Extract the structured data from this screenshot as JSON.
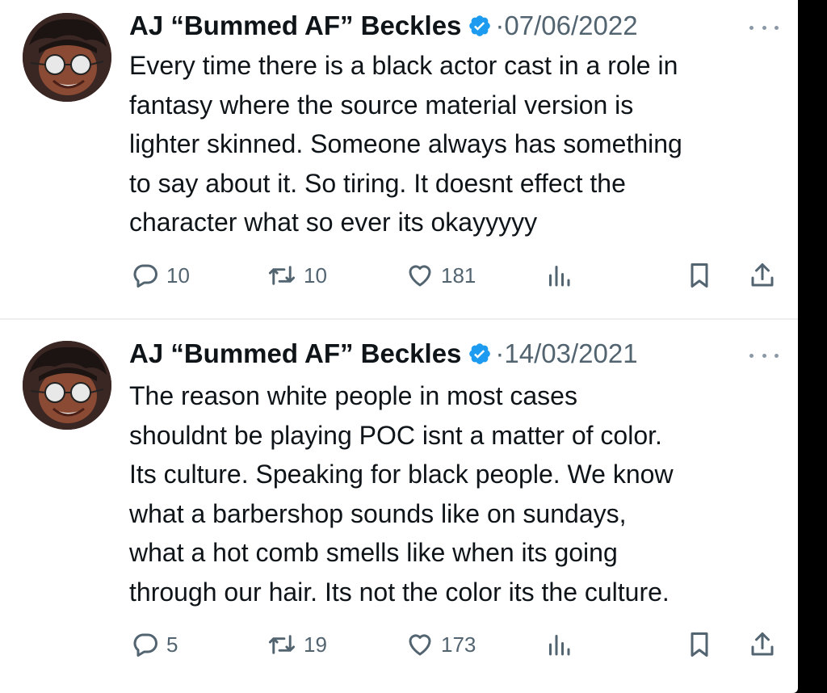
{
  "tweets": [
    {
      "author_name": "AJ “Bummed AF” Beckles",
      "separator": "·",
      "date": "07/06/2022",
      "body_lines": [
        "Every time there is a black actor cast in a role in",
        "fantasy where the source material version is",
        "lighter skinned. Someone always has something",
        "to say about it. So tiring. It doesnt effect the",
        "character what so ever its okayyyyy"
      ],
      "replies": "10",
      "retweets": "10",
      "likes": "181"
    },
    {
      "author_name": "AJ “Bummed AF” Beckles",
      "separator": "·",
      "date": "14/03/2021",
      "body_lines": [
        "The reason white people in most cases",
        "shouldnt be playing POC isnt a matter of color.",
        "Its culture. Speaking for black people. We know",
        "what a barbershop sounds like on sundays,",
        "what a hot comb smells like when its going",
        "through our hair. Its not the color its the culture."
      ],
      "replies": "5",
      "retweets": "19",
      "likes": "173"
    }
  ],
  "icons": {
    "verified": "verified-badge-icon",
    "more": "more-icon",
    "reply": "reply-icon",
    "retweet": "retweet-icon",
    "like": "heart-icon",
    "views": "views-icon",
    "bookmark": "bookmark-icon",
    "share": "share-icon"
  },
  "colors": {
    "text": "#0f1419",
    "secondary": "#536471",
    "verified": "#1d9bf0",
    "background": "#ffffff",
    "outer": "#000000"
  }
}
